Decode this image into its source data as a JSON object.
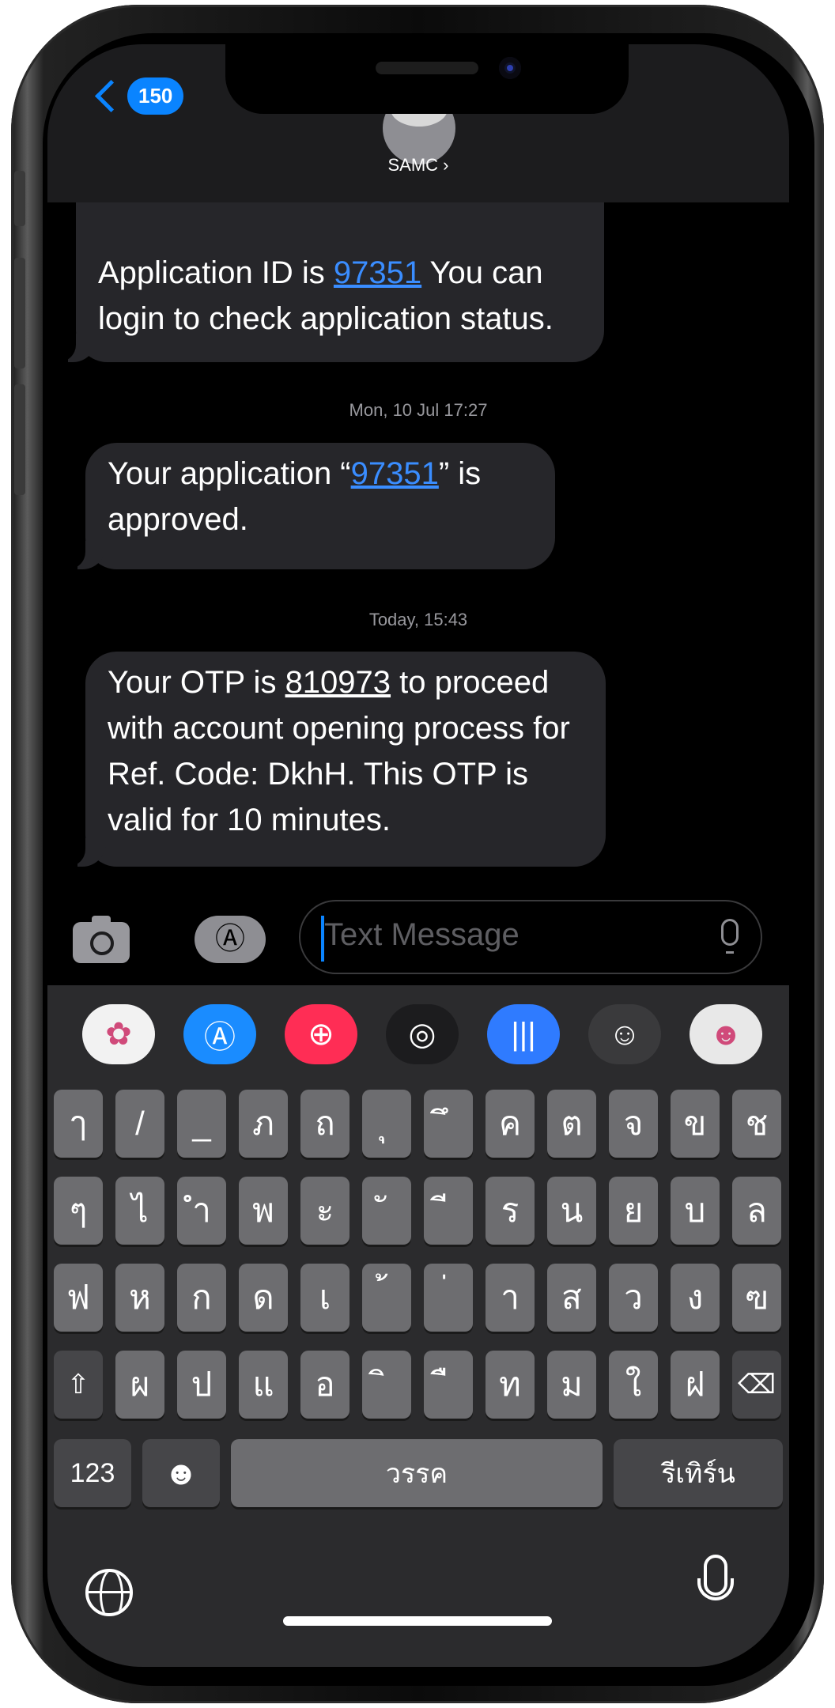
{
  "header": {
    "back_count": "150",
    "contact_name": "SAMC ›"
  },
  "messages": [
    {
      "parts": [
        "Application ID is ",
        "97351",
        " You can login to check application status."
      ]
    },
    {
      "timestamp": "Mon, 10 Jul 17:27",
      "parts": [
        "Your application “",
        "97351",
        "” is approved."
      ]
    },
    {
      "timestamp": "Today, 15:43",
      "parts": [
        "Your OTP is ",
        "810973",
        " to proceed with account opening process for Ref. Code: DkhH. This OTP is valid for 10 minutes."
      ]
    }
  ],
  "compose": {
    "placeholder": "Text Message"
  },
  "app_strip": [
    {
      "icon": "photos-icon",
      "bg": "#f2f2f2",
      "glyph": "✿"
    },
    {
      "icon": "app-store-icon",
      "bg": "#1a8cff",
      "glyph": "Ⓐ"
    },
    {
      "icon": "image-search-icon",
      "bg": "#ff2d55",
      "glyph": "⊕"
    },
    {
      "icon": "activity-icon",
      "bg": "#1c1c1e",
      "glyph": "◎"
    },
    {
      "icon": "audio-message-icon",
      "bg": "#2f7bff",
      "glyph": "|||"
    },
    {
      "icon": "memoji-icon",
      "bg": "#3a3a3c",
      "glyph": "☺"
    },
    {
      "icon": "memoji-stickers-icon",
      "bg": "#e8e8e8",
      "glyph": "☻"
    }
  ],
  "keyboard": {
    "row1": [
      "ๅ",
      "/",
      "_",
      "ภ",
      "ถ",
      "ุ",
      "ึ",
      "ค",
      "ต",
      "จ",
      "ข",
      "ช"
    ],
    "row2": [
      "ๆ",
      "ไ",
      "ำ",
      "พ",
      "ะ",
      "ั",
      "ี",
      "ร",
      "น",
      "ย",
      "บ",
      "ล"
    ],
    "row3": [
      "ฟ",
      "ห",
      "ก",
      "ด",
      "เ",
      "้",
      "่",
      "า",
      "ส",
      "ว",
      "ง",
      "ฃ"
    ],
    "row4": [
      "ผ",
      "ป",
      "แ",
      "อ",
      "ิ",
      "ื",
      "ท",
      "ม",
      "ใ",
      "ฝ"
    ],
    "shift": "⇧",
    "delete": "⌫",
    "numbers": "123",
    "emoji": "☻",
    "space": "วรรค",
    "return": "รีเทิร์น"
  }
}
